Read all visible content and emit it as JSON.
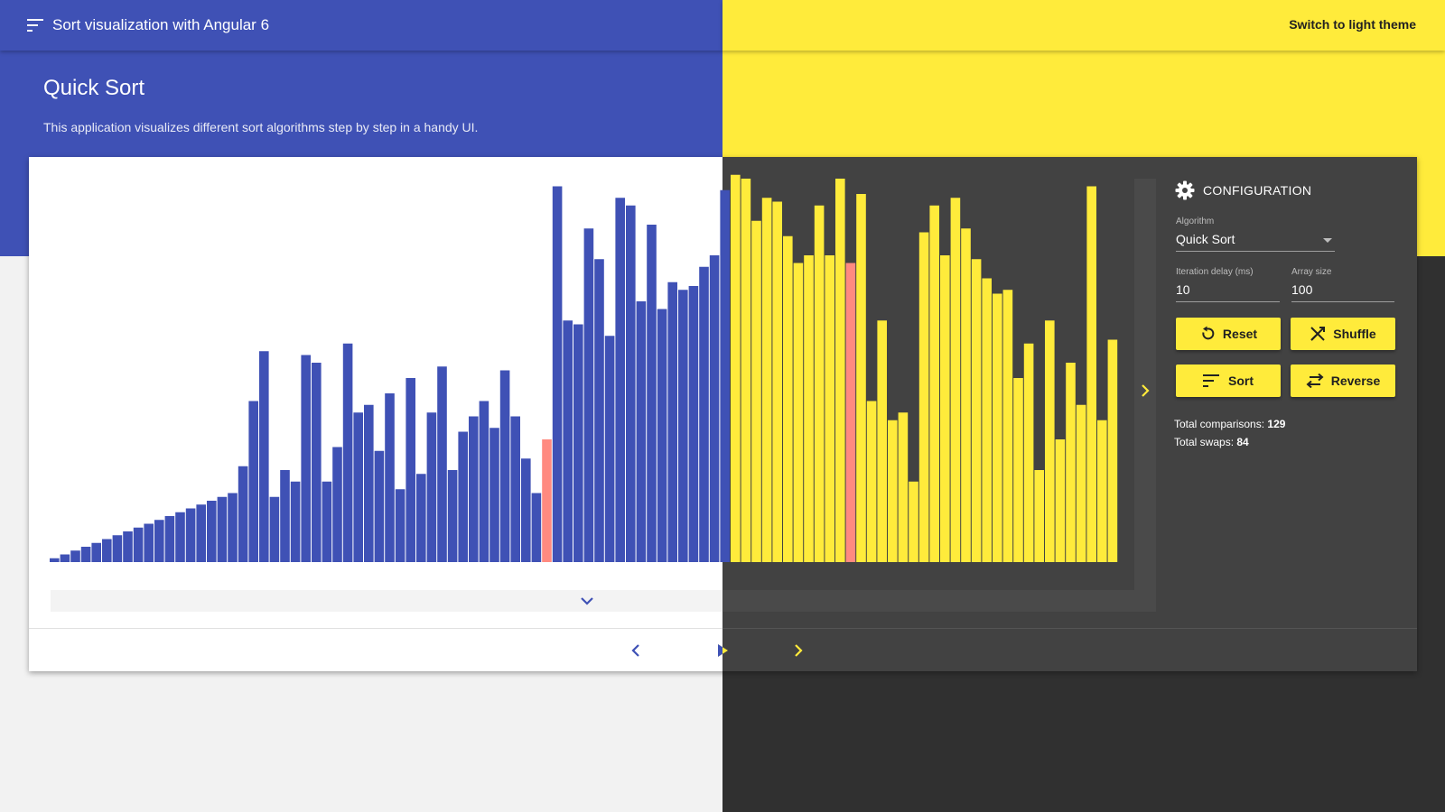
{
  "app": {
    "title": "Sort visualization with Angular 6",
    "theme_button": "Switch to light theme"
  },
  "hero": {
    "title": "Quick Sort",
    "description": "This application visualizes different sort algorithms step by step in a handy UI."
  },
  "colors": {
    "primary": "#3f51b5",
    "accent": "#ffeb3b",
    "highlight": "#ff8a80",
    "dark_card": "#424242"
  },
  "config": {
    "heading": "CONFIGURATION",
    "algorithm": {
      "label": "Algorithm",
      "value": "Quick Sort"
    },
    "delay": {
      "label": "Iteration delay (ms)",
      "value": "10"
    },
    "size": {
      "label": "Array size",
      "value": "100"
    },
    "buttons": {
      "reset": "Reset",
      "shuffle": "Shuffle",
      "sort": "Sort",
      "reverse": "Reverse"
    },
    "stats": {
      "comparisons_label": "Total comparisons:",
      "comparisons": "129",
      "swaps_label": "Total swaps: ",
      "swaps": "84"
    }
  },
  "chart_data": {
    "type": "bar",
    "highlight_indices": [
      47,
      76
    ],
    "values": [
      1,
      2,
      3,
      4,
      5,
      6,
      7,
      8,
      9,
      10,
      11,
      12,
      13,
      14,
      15,
      16,
      17,
      18,
      25,
      42,
      55,
      17,
      24,
      21,
      54,
      52,
      21,
      30,
      57,
      39,
      41,
      29,
      44,
      19,
      48,
      23,
      39,
      51,
      24,
      34,
      38,
      42,
      35,
      50,
      38,
      27,
      18,
      32,
      98,
      63,
      62,
      87,
      79,
      59,
      95,
      93,
      68,
      88,
      66,
      73,
      71,
      72,
      77,
      80,
      97,
      101,
      100,
      89,
      95,
      94,
      85,
      78,
      80,
      93,
      80,
      100,
      78,
      96,
      42,
      63,
      37,
      39,
      21,
      86,
      93,
      80,
      95,
      87,
      79,
      74,
      70,
      71,
      48,
      57,
      24,
      63,
      32,
      52,
      41,
      98,
      37,
      58
    ]
  }
}
